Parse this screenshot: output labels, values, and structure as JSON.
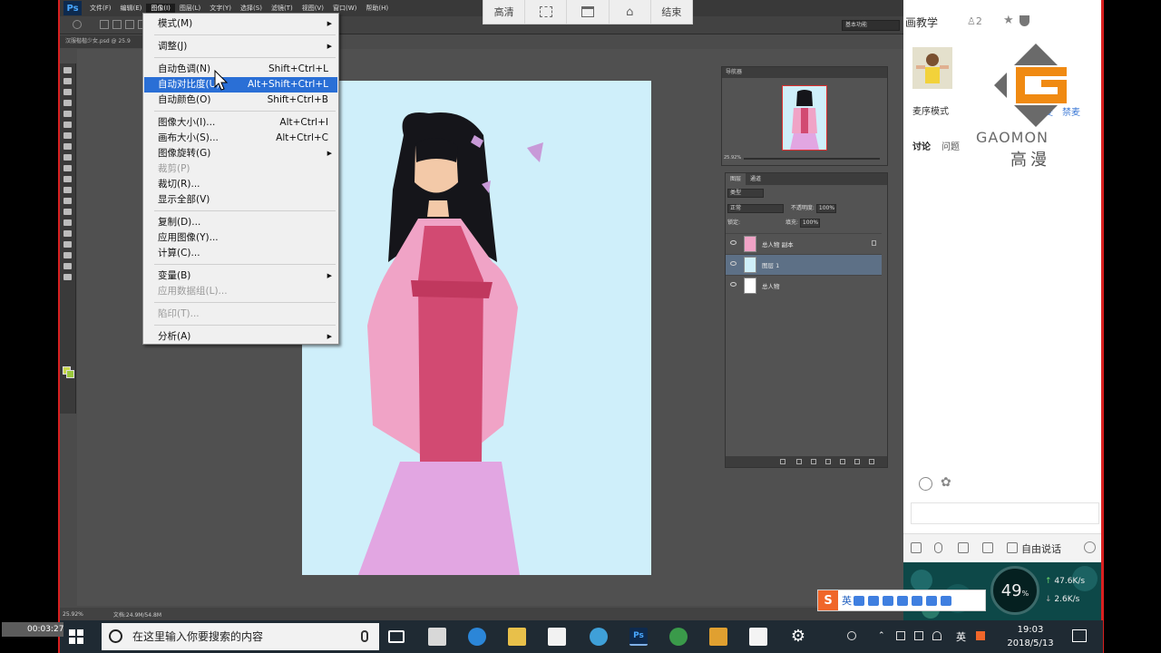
{
  "ps": {
    "logo": "Ps",
    "menus": [
      "文件(F)",
      "编辑(E)",
      "图像(I)",
      "图层(L)",
      "文字(Y)",
      "选择(S)",
      "滤镜(T)",
      "视图(V)",
      "窗口(W)",
      "帮助(H)"
    ],
    "active_menu": "图像(I)",
    "workspace": "基本功能",
    "doc_tab": "汉服楷楷少女.psd @ 25.9",
    "status_zoom": "25.92%",
    "status_doc": "文档:24.9M/54.8M"
  },
  "image_menu": {
    "items": [
      {
        "label": "模式(M)",
        "shortcut": "",
        "submenu": true,
        "disabled": false,
        "selected": false
      },
      {
        "label": "调整(J)",
        "shortcut": "",
        "submenu": true,
        "disabled": false,
        "selected": false
      },
      {
        "label": "自动色调(N)",
        "shortcut": "Shift+Ctrl+L",
        "submenu": false,
        "disabled": false,
        "selected": false
      },
      {
        "label": "自动对比度(U)",
        "shortcut": "Alt+Shift+Ctrl+L",
        "submenu": false,
        "disabled": false,
        "selected": true
      },
      {
        "label": "自动颜色(O)",
        "shortcut": "Shift+Ctrl+B",
        "submenu": false,
        "disabled": false,
        "selected": false
      },
      {
        "label": "图像大小(I)...",
        "shortcut": "Alt+Ctrl+I",
        "submenu": false,
        "disabled": false,
        "selected": false
      },
      {
        "label": "画布大小(S)...",
        "shortcut": "Alt+Ctrl+C",
        "submenu": false,
        "disabled": false,
        "selected": false
      },
      {
        "label": "图像旋转(G)",
        "shortcut": "",
        "submenu": true,
        "disabled": false,
        "selected": false
      },
      {
        "label": "裁剪(P)",
        "shortcut": "",
        "submenu": false,
        "disabled": true,
        "selected": false
      },
      {
        "label": "裁切(R)...",
        "shortcut": "",
        "submenu": false,
        "disabled": false,
        "selected": false
      },
      {
        "label": "显示全部(V)",
        "shortcut": "",
        "submenu": false,
        "disabled": false,
        "selected": false
      },
      {
        "label": "复制(D)...",
        "shortcut": "",
        "submenu": false,
        "disabled": false,
        "selected": false
      },
      {
        "label": "应用图像(Y)...",
        "shortcut": "",
        "submenu": false,
        "disabled": false,
        "selected": false
      },
      {
        "label": "计算(C)...",
        "shortcut": "",
        "submenu": false,
        "disabled": false,
        "selected": false
      },
      {
        "label": "变量(B)",
        "shortcut": "",
        "submenu": true,
        "disabled": false,
        "selected": false
      },
      {
        "label": "应用数据组(L)...",
        "shortcut": "",
        "submenu": false,
        "disabled": true,
        "selected": false
      },
      {
        "label": "陷印(T)...",
        "shortcut": "",
        "submenu": false,
        "disabled": true,
        "selected": false
      },
      {
        "label": "分析(A)",
        "shortcut": "",
        "submenu": true,
        "disabled": false,
        "selected": false
      }
    ]
  },
  "navigator": {
    "title": "导航器",
    "zoom": "25.92%"
  },
  "layers": {
    "tabs": [
      "图层",
      "通道"
    ],
    "filter": "类型",
    "blend_mode": "正常",
    "opacity_label": "不透明度:",
    "opacity": "100%",
    "lock_label": "锁定:",
    "fill_label": "填充:",
    "fill": "100%",
    "items": [
      {
        "name": "总人物 副本",
        "selected": false,
        "locked": true
      },
      {
        "name": "图层 1",
        "selected": true,
        "locked": false
      },
      {
        "name": "总人物",
        "selected": false,
        "locked": false
      }
    ]
  },
  "stream_bar": {
    "items": [
      "高清",
      "",
      "",
      "",
      "结束"
    ]
  },
  "right_panel": {
    "title": "画教学",
    "online_count": "2",
    "mode": "麦序模式",
    "link1": "麦",
    "link2": "禁麦",
    "tab_discuss": "讨论",
    "tab_question": "问题",
    "brand": "GAOMON",
    "brand_cn": "高漫",
    "free_talk": "自由说话"
  },
  "net": {
    "cpu": "49",
    "cpu_unit": "%",
    "up": "47.6",
    "up_unit": "K/s",
    "down": "2.6",
    "down_unit": "K/s"
  },
  "ime": {
    "label": "英"
  },
  "taskbar": {
    "record_time": "00:03:27",
    "search_placeholder": "在这里输入你要搜索的内容",
    "tray_lang": "英",
    "time": "19:03",
    "date": "2018/5/13"
  },
  "colors": {
    "accent_select": "#2a6fd6",
    "frame_red": "#d92020",
    "canvas_bg": "#cfeffa",
    "gaomon_orange": "#f08a12"
  }
}
